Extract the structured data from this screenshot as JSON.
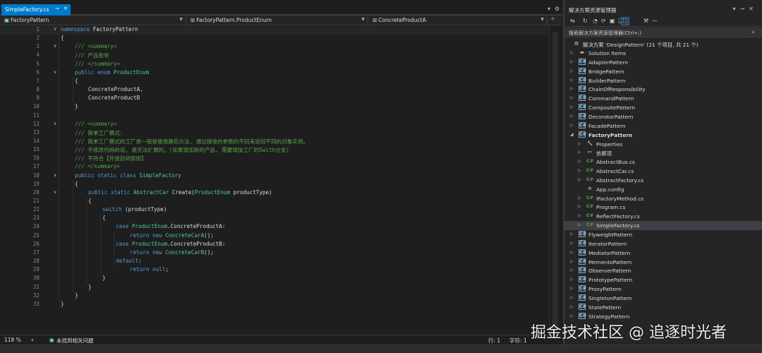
{
  "editor": {
    "tab": {
      "filename": "SimpleFactory.cs",
      "pin_icon": "pin-icon",
      "close_icon": "close-icon"
    },
    "tab_right_icons": [
      "▾",
      "⚙"
    ],
    "nav": {
      "project": "FactoryPattern",
      "type": "FactoryPattern.ProductEnum",
      "member": "ConcreteProductA"
    },
    "code_lines": [
      {
        "n": "1",
        "parts": [
          [
            "kw",
            "namespace"
          ],
          [
            "nm",
            " FactoryPattern"
          ]
        ],
        "indent": 86
      },
      {
        "n": "2",
        "parts": [
          [
            "nm",
            "{"
          ]
        ],
        "indent": 86
      },
      {
        "n": "3",
        "parts": [
          [
            "cm",
            "/// <summary>"
          ]
        ],
        "indent": 106
      },
      {
        "n": "4",
        "parts": [
          [
            "cm",
            "/// 产品枚举"
          ]
        ],
        "indent": 106
      },
      {
        "n": "5",
        "parts": [
          [
            "cm",
            "/// </summary>"
          ]
        ],
        "indent": 106
      },
      {
        "n": "6",
        "parts": [
          [
            "kw",
            "public enum "
          ],
          [
            "ty",
            "ProductEnum"
          ]
        ],
        "indent": 106
      },
      {
        "n": "7",
        "parts": [
          [
            "nm",
            "{"
          ]
        ],
        "indent": 106
      },
      {
        "n": "8",
        "parts": [
          [
            "nm",
            "ConcreteProductA,"
          ]
        ],
        "indent": 125
      },
      {
        "n": "9",
        "parts": [
          [
            "nm",
            "ConcreteProductB"
          ]
        ],
        "indent": 125
      },
      {
        "n": "10",
        "parts": [
          [
            "nm",
            "}"
          ]
        ],
        "indent": 106
      },
      {
        "n": "11",
        "parts": [],
        "indent": 106
      },
      {
        "n": "12",
        "parts": [
          [
            "cm",
            "/// <summary>"
          ]
        ],
        "indent": 106
      },
      {
        "n": "13",
        "parts": [
          [
            "cm",
            "/// 简单工厂模式:"
          ]
        ],
        "indent": 106
      },
      {
        "n": "14",
        "parts": [
          [
            "cm",
            "/// 简单工厂模式的工厂类一般是使用静态方法, 通过接收的参数的不同来返回不同的对象实例。"
          ]
        ],
        "indent": 106
      },
      {
        "n": "15",
        "parts": [
          [
            "cm",
            "/// 不修改代码的话, 是无法扩展的。(如果增加新的产品, 需要增加工厂的Swith分支)"
          ]
        ],
        "indent": 106
      },
      {
        "n": "16",
        "parts": [
          [
            "cm",
            "/// 不符合【开放封闭原则】"
          ]
        ],
        "indent": 106
      },
      {
        "n": "17",
        "parts": [
          [
            "cm",
            "/// </summary>"
          ]
        ],
        "indent": 106
      },
      {
        "n": "18",
        "parts": [
          [
            "kw",
            "public static class "
          ],
          [
            "ty",
            "SimpleFactory"
          ]
        ],
        "indent": 106
      },
      {
        "n": "19",
        "parts": [
          [
            "nm",
            "{"
          ]
        ],
        "indent": 106
      },
      {
        "n": "20",
        "parts": [
          [
            "kw",
            "public static "
          ],
          [
            "ty",
            "AbstractCar"
          ],
          [
            "nm",
            " Create("
          ],
          [
            "ty",
            "ProductEnum"
          ],
          [
            "nm",
            " productType)"
          ]
        ],
        "indent": 125
      },
      {
        "n": "21",
        "parts": [
          [
            "nm",
            "{"
          ]
        ],
        "indent": 125
      },
      {
        "n": "22",
        "parts": [
          [
            "kw",
            "switch"
          ],
          [
            "nm",
            " (productType)"
          ]
        ],
        "indent": 145
      },
      {
        "n": "23",
        "parts": [
          [
            "nm",
            "{"
          ]
        ],
        "indent": 145
      },
      {
        "n": "24",
        "parts": [
          [
            "kw",
            "case "
          ],
          [
            "ty",
            "ProductEnum"
          ],
          [
            "nm",
            ".ConcreteProductA:"
          ]
        ],
        "indent": 164
      },
      {
        "n": "25",
        "parts": [
          [
            "kw",
            "return new "
          ],
          [
            "ty",
            "ConcreteCarA"
          ],
          [
            "nm",
            "();"
          ]
        ],
        "indent": 184
      },
      {
        "n": "26",
        "parts": [
          [
            "kw",
            "case "
          ],
          [
            "ty",
            "ProductEnum"
          ],
          [
            "nm",
            ".ConcreteProductB:"
          ]
        ],
        "indent": 164
      },
      {
        "n": "27",
        "parts": [
          [
            "kw",
            "return new "
          ],
          [
            "ty",
            "ConcreteCarB"
          ],
          [
            "nm",
            "();"
          ]
        ],
        "indent": 184
      },
      {
        "n": "28",
        "parts": [
          [
            "kw",
            "default"
          ],
          [
            "nm",
            ":"
          ]
        ],
        "indent": 164
      },
      {
        "n": "29",
        "parts": [
          [
            "kw",
            "return "
          ],
          [
            "kw",
            "null"
          ],
          [
            "nm",
            ";"
          ]
        ],
        "indent": 184
      },
      {
        "n": "30",
        "parts": [
          [
            "nm",
            "}"
          ]
        ],
        "indent": 145
      },
      {
        "n": "31",
        "parts": [
          [
            "nm",
            "}"
          ]
        ],
        "indent": 125
      },
      {
        "n": "32",
        "parts": [
          [
            "nm",
            "}"
          ]
        ],
        "indent": 106
      },
      {
        "n": "33",
        "parts": [
          [
            "nm",
            "}"
          ]
        ],
        "indent": 86
      }
    ],
    "fold_lines": [
      "1",
      "3",
      "6",
      "12",
      "18",
      "20"
    ],
    "status": {
      "zoom": "118 %",
      "issues": "未找到相关问题",
      "line": "行: 1",
      "char": "字符: 1"
    }
  },
  "explorer": {
    "title": "解决方案资源管理器",
    "search_placeholder": "搜索解决方案资源管理器(Ctrl+;)",
    "solution_label": "解决方案 'DesignPattern' (21 个项目, 共 21 个)",
    "items": [
      {
        "label": "Solution Items",
        "level": 0,
        "icon": "folder",
        "arrow": "▷"
      },
      {
        "label": "AdapterPattern",
        "level": 0,
        "icon": "proj",
        "arrow": "▷"
      },
      {
        "label": "BridgePattern",
        "level": 0,
        "icon": "proj",
        "arrow": "▷"
      },
      {
        "label": "BuilderPattern",
        "level": 0,
        "icon": "proj",
        "arrow": "▷"
      },
      {
        "label": "ChainOfResponsibility",
        "level": 0,
        "icon": "proj",
        "arrow": "▷"
      },
      {
        "label": "CommandPattern",
        "level": 0,
        "icon": "proj",
        "arrow": "▷"
      },
      {
        "label": "CompositePattern",
        "level": 0,
        "icon": "proj",
        "arrow": "▷"
      },
      {
        "label": "DecoratorPattern",
        "level": 0,
        "icon": "proj",
        "arrow": "▷"
      },
      {
        "label": "FacadePattern",
        "level": 0,
        "icon": "proj",
        "arrow": "▷"
      },
      {
        "label": "FactoryPattern",
        "level": 0,
        "icon": "proj",
        "arrow": "◢",
        "bold": true
      },
      {
        "label": "Properties",
        "level": 1,
        "icon": "prop",
        "arrow": "▷"
      },
      {
        "label": "依赖项",
        "level": 1,
        "icon": "ref",
        "arrow": "▷"
      },
      {
        "label": "AbstractBus.cs",
        "level": 1,
        "icon": "cs",
        "arrow": "▷"
      },
      {
        "label": "AbstractCar.cs",
        "level": 1,
        "icon": "cs",
        "arrow": "▷"
      },
      {
        "label": "AbstractFactory.cs",
        "level": 1,
        "icon": "cs",
        "arrow": "▷"
      },
      {
        "label": "App.config",
        "level": 1,
        "icon": "cfg",
        "arrow": ""
      },
      {
        "label": "IFactoryMethod.cs",
        "level": 1,
        "icon": "cs",
        "arrow": "▷"
      },
      {
        "label": "Program.cs",
        "level": 1,
        "icon": "cs",
        "arrow": "▷"
      },
      {
        "label": "ReflectFactory.cs",
        "level": 1,
        "icon": "cs",
        "arrow": "▷"
      },
      {
        "label": "SimpleFactory.cs",
        "level": 1,
        "icon": "cs",
        "arrow": "▷",
        "selected": true
      },
      {
        "label": "FlyweightPattern",
        "level": 0,
        "icon": "proj",
        "arrow": "▷"
      },
      {
        "label": "IteratorPattern",
        "level": 0,
        "icon": "proj",
        "arrow": "▷"
      },
      {
        "label": "MediatorPattern",
        "level": 0,
        "icon": "proj",
        "arrow": "▷"
      },
      {
        "label": "MementoPattern",
        "level": 0,
        "icon": "proj",
        "arrow": "▷"
      },
      {
        "label": "ObserverPattern",
        "level": 0,
        "icon": "proj",
        "arrow": "▷"
      },
      {
        "label": "PrototypePattern",
        "level": 0,
        "icon": "proj",
        "arrow": "▷"
      },
      {
        "label": "ProxyPattern",
        "level": 0,
        "icon": "proj",
        "arrow": "▷"
      },
      {
        "label": "SingletonPattern",
        "level": 0,
        "icon": "proj",
        "arrow": "▷"
      },
      {
        "label": "StatePattern",
        "level": 0,
        "icon": "proj",
        "arrow": "▷"
      },
      {
        "label": "StrategyPattern",
        "level": 0,
        "icon": "proj",
        "arrow": "▷"
      }
    ]
  },
  "watermark": "掘金技术社区 @ 追逐时光者"
}
